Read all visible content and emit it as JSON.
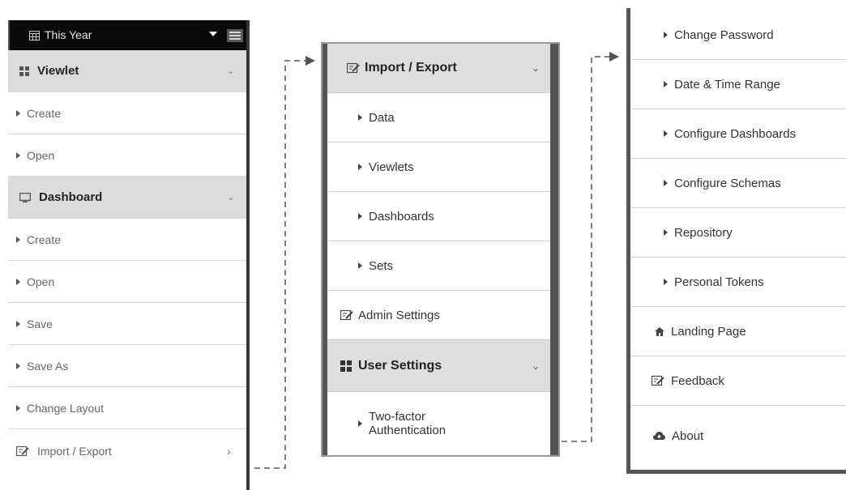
{
  "panel1": {
    "topbar": {
      "range_label": "This Year"
    },
    "viewlet": {
      "label": "Viewlet",
      "items": [
        "Create",
        "Open"
      ]
    },
    "dashboard": {
      "label": "Dashboard",
      "items": [
        "Create",
        "Open",
        "Save",
        "Save As",
        "Change Layout"
      ]
    },
    "import_export": {
      "label": "Import / Export"
    }
  },
  "panel2": {
    "import_export": {
      "label": "Import / Export",
      "items": [
        "Data",
        "Viewlets",
        "Dashboards",
        "Sets"
      ]
    },
    "admin_settings": {
      "label": "Admin Settings"
    },
    "user_settings": {
      "label": "User Settings",
      "items": [
        "Two-factor",
        "Authentication"
      ]
    }
  },
  "panel3": {
    "items": [
      "Change Password",
      "Date & Time Range",
      "Configure Dashboards",
      "Configure Schemas",
      "Repository",
      "Personal Tokens"
    ],
    "landing_page": "Landing Page",
    "feedback": "Feedback",
    "about": "About"
  },
  "icons": {
    "calendar": "calendar-icon",
    "menu": "hamburger-icon",
    "viewlet": "grid-icon",
    "dashboard": "monitor-icon",
    "edit": "edit-icon",
    "home": "home-icon",
    "cloud": "cloud-icon"
  },
  "colors": {
    "topbar": "#0a0a0a",
    "header_bg": "#dcdcdc",
    "panel_border": "#555555"
  }
}
